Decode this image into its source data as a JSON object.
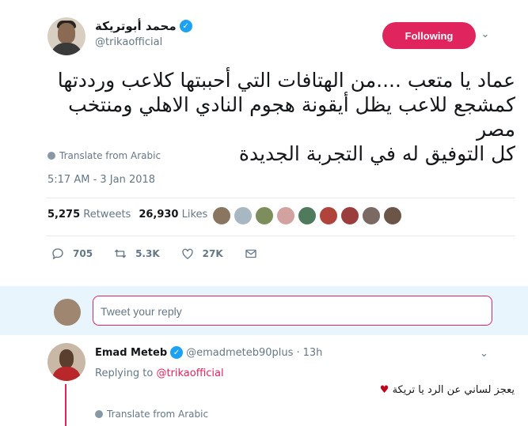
{
  "author": {
    "display_name": "محمد أبوتريكة",
    "handle": "@trikaofficial"
  },
  "follow_button": "Following",
  "tweet": {
    "text_lines": [
      "عماد يا متعب ....من الهتافات التي أحببتها كلاعب ورددتها",
      "كمشجع للاعب يظل أيقونة هجوم النادي الاهلي ومنتخب مصر",
      "كل التوفيق له في التجربة الجديدة"
    ],
    "translate_label": "Translate from Arabic",
    "timestamp": "5:17 AM - 3 Jan 2018"
  },
  "stats": {
    "retweets_count": "5,275",
    "retweets_label": "Retweets",
    "likes_count": "26,930",
    "likes_label": "Likes"
  },
  "actions": {
    "replies": "705",
    "retweets": "5.3K",
    "likes": "27K"
  },
  "reply_box": {
    "placeholder": "Tweet your reply"
  },
  "reply": {
    "display_name": "Emad Meteb",
    "handle": "@emadmeteb90plus",
    "separator": "·",
    "time": "13h",
    "replying_prefix": "Replying to",
    "replying_to": "@trikaofficial",
    "text": "يعجز لساني عن الرد يا تريكة",
    "heart": "♥",
    "translate_label": "Translate from Arabic"
  },
  "colors": {
    "accent": "#e0245e",
    "verified": "#1da1f2",
    "muted": "#657786"
  },
  "liker_colors": [
    "#8a7560",
    "#a7b8c2",
    "#7d8d5c",
    "#d1a2a0",
    "#4f7a5b",
    "#b0433a",
    "#9c3d3d",
    "#7a6a63",
    "#6b5546"
  ]
}
